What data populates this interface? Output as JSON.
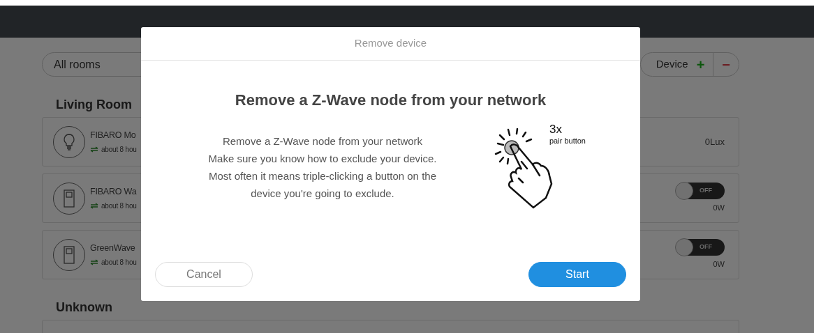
{
  "toolbar": {
    "room_filter": "All rooms",
    "device_label": "Device",
    "add_symbol": "+",
    "remove_symbol": "−"
  },
  "sections": [
    {
      "title": "Living Room",
      "devices": [
        {
          "kind": "sensor",
          "name": "FIBARO Mo",
          "status": "about 8 hou",
          "reading": "0Lux"
        },
        {
          "kind": "switch",
          "name": "FIBARO Wa",
          "status": "about 8 hou",
          "on": false,
          "toggle_label": "OFF",
          "reading": "0W"
        },
        {
          "kind": "switch",
          "name": "GreenWave",
          "status": "about 8 hou",
          "on": false,
          "toggle_label": "OFF",
          "reading": "0W"
        }
      ]
    },
    {
      "title": "Unknown",
      "devices": [
        {
          "kind": "empty"
        }
      ]
    }
  ],
  "dialog": {
    "title": "Remove device",
    "heading": "Remove a Z-Wave node from your network",
    "body": [
      "Remove a Z-Wave node from your network",
      "Make sure you know how to exclude your device. Most often it means triple-clicking a button on the device you're going to exclude."
    ],
    "illustration_count": "3x",
    "illustration_caption": "pair button",
    "buttons": [
      {
        "kind": "secondary",
        "label": "Cancel"
      },
      {
        "kind": "primary",
        "label": "Start"
      }
    ]
  }
}
